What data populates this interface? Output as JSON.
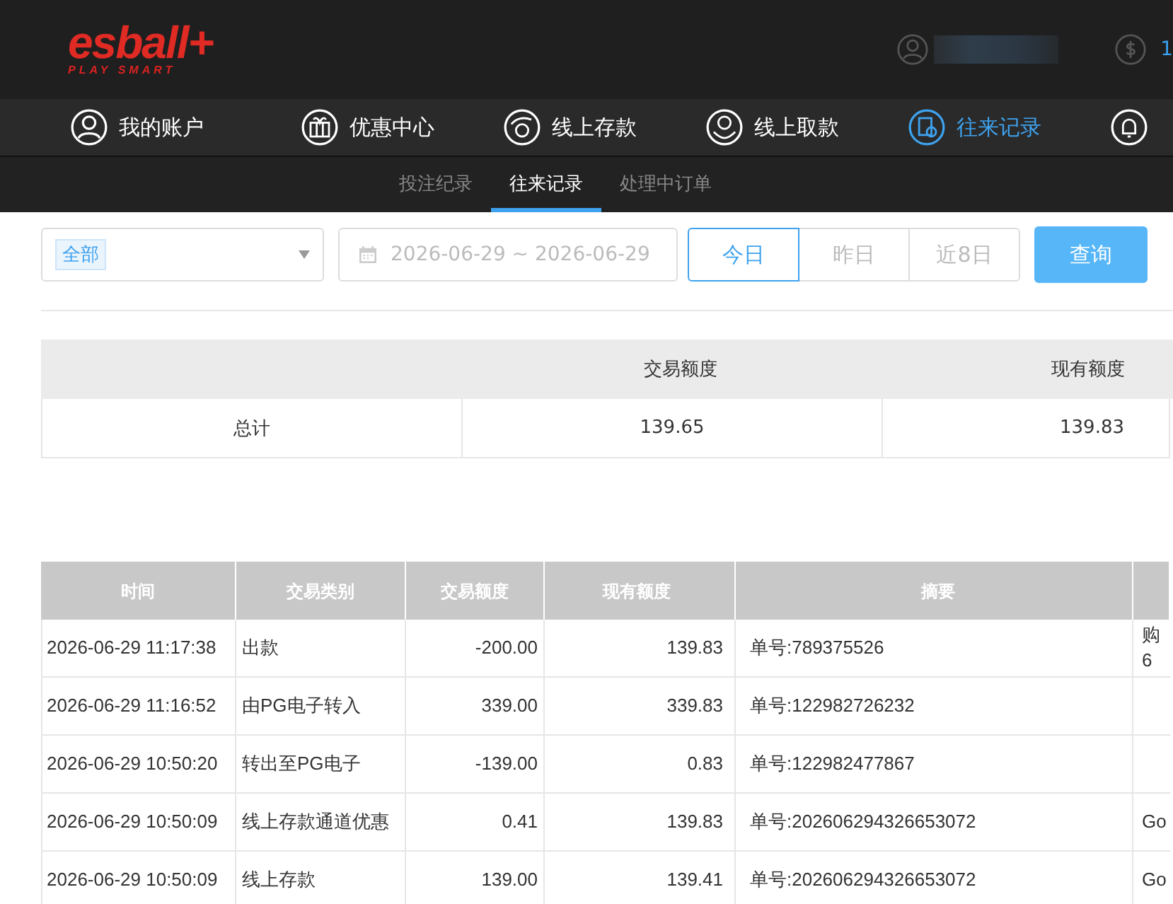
{
  "header": {
    "logo": "esball+",
    "tagline": "PLAY SMART",
    "balance": "1"
  },
  "nav": [
    {
      "label": "我的账户",
      "kind": "user",
      "selected": false
    },
    {
      "label": "优惠中心",
      "kind": "gift",
      "selected": false
    },
    {
      "label": "线上存款",
      "kind": "deposit",
      "selected": false
    },
    {
      "label": "线上取款",
      "kind": "withdraw",
      "selected": false
    },
    {
      "label": "往来记录",
      "kind": "record",
      "selected": true
    },
    {
      "kind": "bell",
      "selected": false
    }
  ],
  "subtabs": [
    {
      "label": "投注纪录",
      "selected": false
    },
    {
      "label": "往来记录",
      "selected": true
    },
    {
      "label": "处理中订单",
      "selected": false
    }
  ],
  "filters": {
    "type_tag": "全部",
    "date_range": "2026-06-29 ~ 2026-06-29",
    "ranges": [
      {
        "label": "今日",
        "selected": true
      },
      {
        "label": "昨日",
        "selected": false
      },
      {
        "label": "近8日",
        "selected": false
      }
    ],
    "query_button": "查询"
  },
  "summary": {
    "columns": [
      "",
      "交易额度",
      "现有额度"
    ],
    "rows": [
      [
        "总计",
        "139.65",
        "139.83"
      ]
    ]
  },
  "table": {
    "columns": [
      "时间",
      "交易类别",
      "交易额度",
      "现有额度",
      "摘要"
    ],
    "rows": [
      [
        "2026-06-29 11:17:38",
        "出款",
        "-200.00",
        "139.83",
        "单号:789375526",
        "购6"
      ],
      [
        "2026-06-29 11:16:52",
        "由PG电子转入",
        "339.00",
        "339.83",
        "单号:122982726232",
        ""
      ],
      [
        "2026-06-29 10:50:20",
        "转出至PG电子",
        "-139.00",
        "0.83",
        "单号:122982477867",
        ""
      ],
      [
        "2026-06-29 10:50:09",
        "线上存款通道优惠",
        "0.41",
        "139.83",
        "单号:202606294326653072",
        "Go"
      ],
      [
        "2026-06-29 10:50:09",
        "线上存款",
        "139.00",
        "139.41",
        "单号:202606294326653072",
        "Go"
      ]
    ]
  }
}
